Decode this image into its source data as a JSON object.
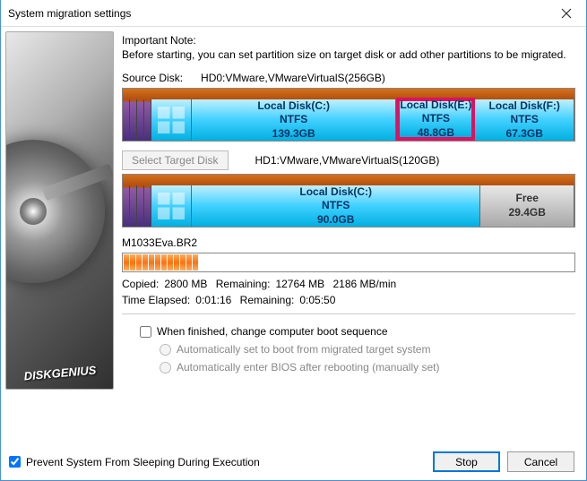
{
  "title": "System migration settings",
  "brand": "DISKGENIUS",
  "note": {
    "heading": "Important Note:",
    "text": "Before starting, you can set partition size on target disk or add other partitions to be migrated."
  },
  "source": {
    "label": "Source Disk:",
    "value": "HD0:VMware,VMwareVirtualS(256GB)",
    "partitions": [
      {
        "name": "Local Disk(C:)",
        "fs": "NTFS",
        "size": "139.3GB"
      },
      {
        "name": "Local Disk(E:)",
        "fs": "NTFS",
        "size": "48.8GB"
      },
      {
        "name": "Local Disk(F:)",
        "fs": "NTFS",
        "size": "67.3GB"
      }
    ]
  },
  "target": {
    "button": "Select Target Disk",
    "value": "HD1:VMware,VMwareVirtualS(120GB)",
    "partitions": [
      {
        "name": "Local Disk(C:)",
        "fs": "NTFS",
        "size": "90.0GB"
      }
    ],
    "free": {
      "label": "Free",
      "size": "29.4GB"
    }
  },
  "progress": {
    "file": "M1033Eva.BR2",
    "copied_label": "Copied:",
    "copied": "2800 MB",
    "remaining_label": "Remaining:",
    "remaining": "12764 MB",
    "rate": "2186 MB/min",
    "elapsed_label": "Time Elapsed:",
    "elapsed": "0:01:16",
    "remaining2_label": "Remaining:",
    "remaining2": "0:05:50"
  },
  "options": {
    "boot_change": "When finished, change computer boot sequence",
    "auto_boot": "Automatically set to boot from migrated target system",
    "auto_bios": "Automatically enter BIOS after rebooting (manually set)"
  },
  "prevent_sleep": "Prevent System From Sleeping During Execution",
  "buttons": {
    "stop": "Stop",
    "cancel": "Cancel"
  }
}
